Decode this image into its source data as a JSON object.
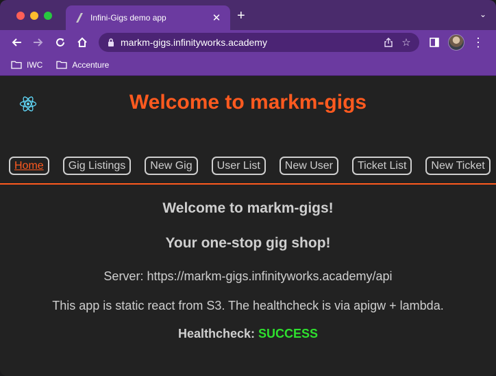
{
  "browser": {
    "tab_title": "Infini-Gigs demo app",
    "url": "markm-gigs.infinityworks.academy",
    "bookmarks": [
      {
        "label": "IWC"
      },
      {
        "label": "Accenture"
      }
    ]
  },
  "app": {
    "title": "Welcome to markm-gigs",
    "nav": [
      {
        "label": "Home",
        "active": true
      },
      {
        "label": "Gig Listings"
      },
      {
        "label": "New Gig"
      },
      {
        "label": "User List"
      },
      {
        "label": "New User"
      },
      {
        "label": "Ticket List"
      },
      {
        "label": "New Ticket"
      }
    ],
    "welcome": "Welcome to markm-gigs!",
    "tagline": "Your one-stop gig shop!",
    "server": "Server: https://markm-gigs.infinityworks.academy/api",
    "description": "This app is static react from S3. The healthcheck is via apigw + lambda.",
    "healthcheck_label": "Healthcheck:",
    "healthcheck_status": "SUCCESS"
  },
  "colors": {
    "accent": "#ff5a1f",
    "success": "#2ee02e",
    "chrome": "#6b3aa0",
    "background": "#222222"
  }
}
